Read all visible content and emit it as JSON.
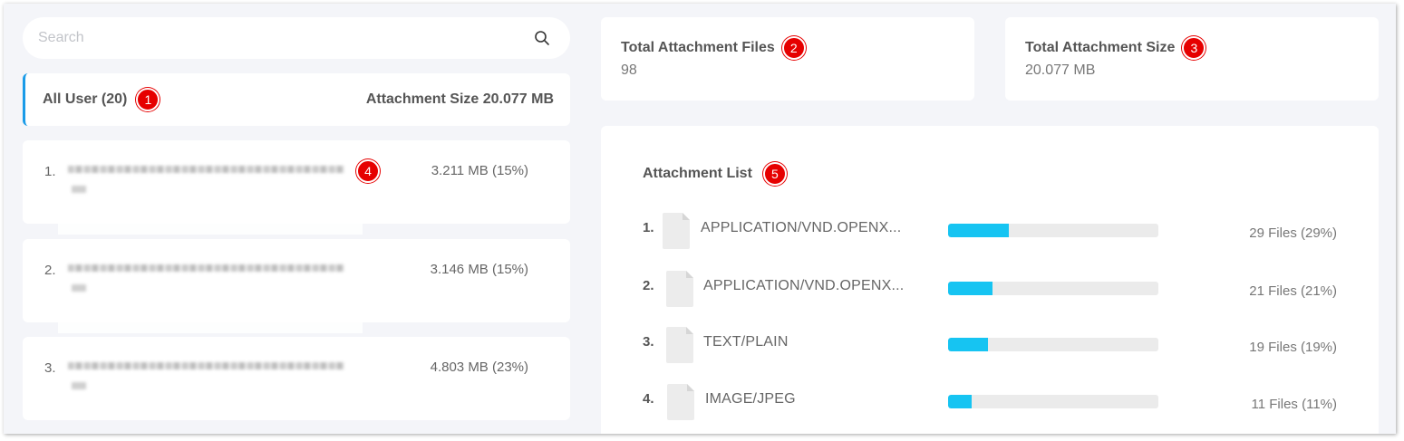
{
  "search": {
    "placeholder": "Search",
    "icon": "search-icon"
  },
  "users_summary": {
    "title": "All User (20)",
    "size_label": "Attachment Size 20.077 MB",
    "badge": "1"
  },
  "users": [
    {
      "index": "1.",
      "size": "3.211 MB (15%)"
    },
    {
      "index": "2.",
      "size": "3.146 MB (15%)"
    },
    {
      "index": "3.",
      "size": "4.803 MB (23%)"
    }
  ],
  "user_badge": "4",
  "stats": {
    "files": {
      "label": "Total Attachment Files",
      "value": "98",
      "badge": "2"
    },
    "size": {
      "label": "Total Attachment Size",
      "value": "20.077 MB",
      "badge": "3"
    }
  },
  "attachments": {
    "title": "Attachment List",
    "badge": "5",
    "items": [
      {
        "index": "1.",
        "type": "APPLICATION/VND.OPENX...",
        "count": "29 Files (29%)",
        "fraction": 0.29
      },
      {
        "index": "2.",
        "type": "APPLICATION/VND.OPENX...",
        "count": "21 Files (21%)",
        "fraction": 0.21
      },
      {
        "index": "3.",
        "type": "TEXT/PLAIN",
        "count": "19 Files (19%)",
        "fraction": 0.19
      },
      {
        "index": "4.",
        "type": "IMAGE/JPEG",
        "count": "11 Files (11%)",
        "fraction": 0.11
      }
    ]
  },
  "colors": {
    "accent": "#1a9be8",
    "bar_fill": "#16c4f2",
    "badge": "#e60000"
  }
}
